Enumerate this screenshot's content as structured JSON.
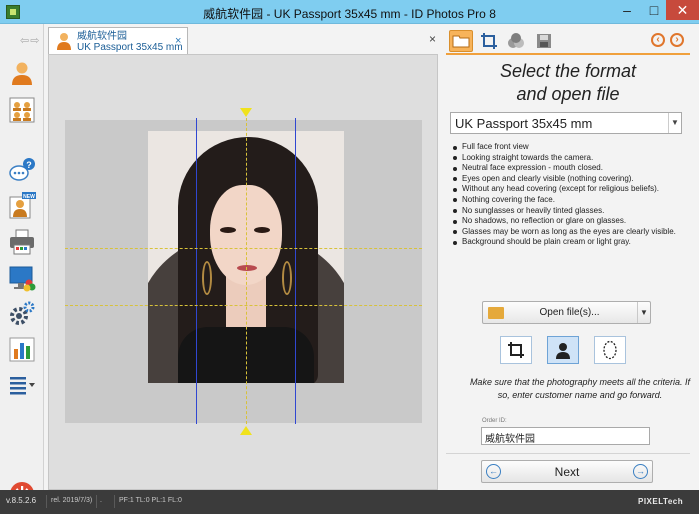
{
  "window": {
    "title": "威航软件园 - UK Passport 35x45 mm - ID Photos Pro 8"
  },
  "toolbar_left": {
    "nav_arrows": "⇦⇨",
    "items": [
      {
        "name": "person-icon"
      },
      {
        "name": "group-icon"
      },
      {
        "name": "help-chat-icon"
      },
      {
        "name": "new-person-icon"
      },
      {
        "name": "printer-icon"
      },
      {
        "name": "monitor-color-icon"
      },
      {
        "name": "settings-gear-icon"
      },
      {
        "name": "statistics-chart-icon"
      },
      {
        "name": "list-menu-icon"
      },
      {
        "name": "power-icon"
      }
    ]
  },
  "document_tab": {
    "line1": "威航软件园",
    "line2": "UK Passport 35x45 mm",
    "close": "×"
  },
  "panel_close": "×",
  "right_panel": {
    "heading_line1": "Select the format",
    "heading_line2": "and open file",
    "format_value": "UK Passport 35x45 mm",
    "criteria": [
      "Full face front view",
      "Looking straight towards the camera.",
      "Neutral face expression - mouth closed.",
      "Eyes open and clearly visible (nothing covering).",
      "Without any head covering (except for religious beliefs).",
      "Nothing covering the face.",
      "No sunglasses or heavily tinted glasses.",
      "No shadows, no reflection or glare on glasses.",
      "Glasses may be worn as long as the eyes are clearly visible.",
      "Background should be plain cream or light gray."
    ],
    "open_button": "Open file(s)...",
    "hint": "Make sure that the photography meets all the criteria. If so, enter customer name and go forward.",
    "order_label": "Order ID:",
    "order_value": "威航软件园",
    "next_button": "Next"
  },
  "status_bar": {
    "version": "v.8.5.2.6",
    "release": "rel. 2019/7/3)",
    "dot": ".",
    "counts": "PF:1 TL:0 PL:1 FL:0",
    "brand": "PIXELTech"
  },
  "colors": {
    "accent_orange": "#f0a03c",
    "title_bar": "#7fcdf0",
    "status_bar": "#3b3b3b",
    "guide_blue": "#3047d1",
    "guide_yellow": "#d8c23a"
  }
}
